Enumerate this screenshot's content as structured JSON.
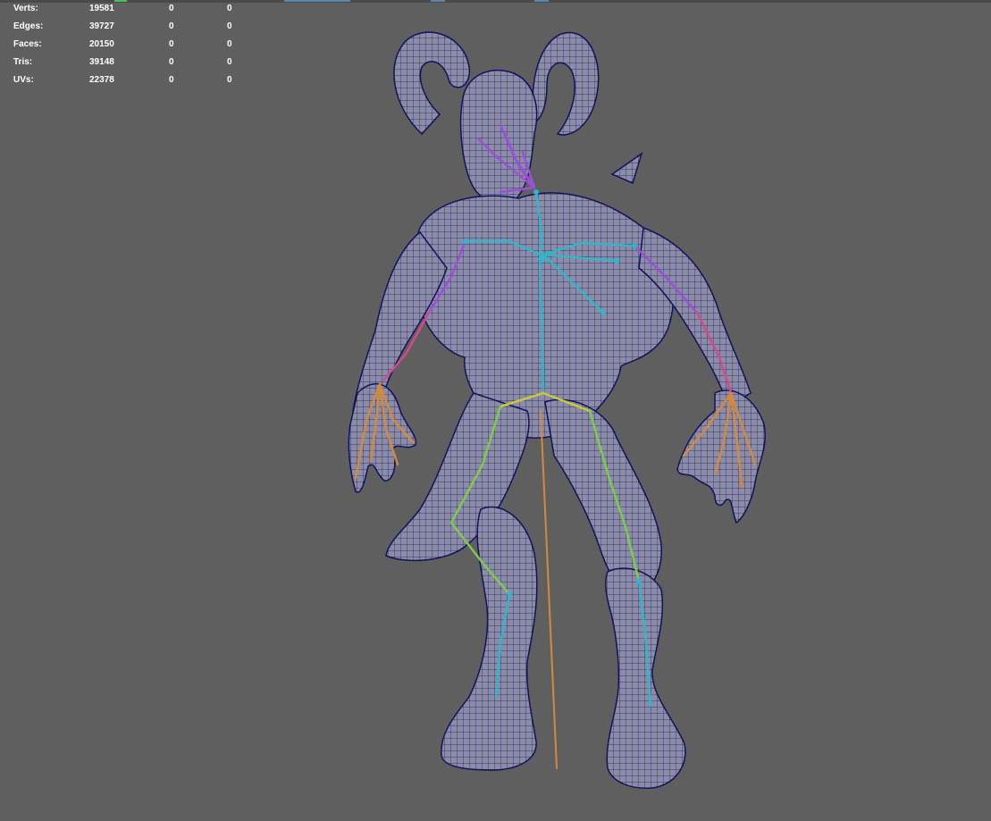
{
  "viewport": {
    "background": "#5f5f5f",
    "heads_up_display": {
      "rows": [
        {
          "label": "Verts:",
          "total": "19581",
          "selected": "0",
          "selected_comp": "0"
        },
        {
          "label": "Edges:",
          "total": "39727",
          "selected": "0",
          "selected_comp": "0"
        },
        {
          "label": "Faces:",
          "total": "20150",
          "selected": "0",
          "selected_comp": "0"
        },
        {
          "label": "Tris:",
          "total": "39148",
          "selected": "0",
          "selected_comp": "0"
        },
        {
          "label": "UVs:",
          "total": "22378",
          "selected": "0",
          "selected_comp": "0"
        }
      ]
    },
    "model": {
      "mesh_fill_color": "#8c8ca6",
      "wireframe_color": "#1a1a66",
      "skeleton_colors": [
        "#9b4fd6",
        "#2fb6c9",
        "#d28a3c",
        "#c8c83c",
        "#7ecb4a",
        "#d24a8a"
      ]
    }
  }
}
